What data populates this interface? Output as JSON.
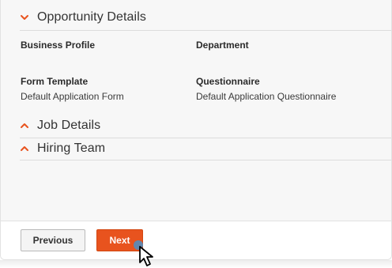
{
  "sections": {
    "opportunity": {
      "title": "Opportunity Details",
      "expanded": true
    },
    "job": {
      "title": "Job Details",
      "expanded": false
    },
    "hiring": {
      "title": "Hiring Team",
      "expanded": false
    }
  },
  "fields": {
    "business_profile": {
      "label": "Business Profile",
      "value": ""
    },
    "department": {
      "label": "Department",
      "value": ""
    },
    "form_template": {
      "label": "Form Template",
      "value": "Default Application Form"
    },
    "questionnaire": {
      "label": "Questionnaire",
      "value": "Default Application Questionnaire"
    }
  },
  "footer": {
    "previous_label": "Previous",
    "next_label": "Next"
  },
  "colors": {
    "accent": "#e8531e",
    "chevron": "#e8531e",
    "cursor_dot": "#4a90c8"
  },
  "icons": {
    "opportunity_chevron": "chevron-down-icon",
    "job_chevron": "chevron-up-icon",
    "hiring_chevron": "chevron-up-icon",
    "pointer": "mouse-pointer-icon"
  }
}
